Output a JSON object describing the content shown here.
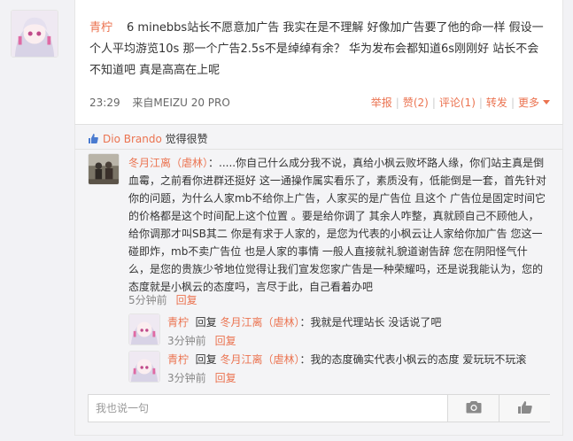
{
  "post": {
    "author": "青柠",
    "content": "6 minebbs站长不愿意加广告 我实在是不理解 好像加广告要了他的命一样 假设一个人平均游览10s 那一个广告2.5s不是绰绰有余？ 华为发布会都知道6s刚刚好 站长不会不知道吧 真是高高在上呢",
    "time": "23:29",
    "source": "来自MEIZU 20 PRO",
    "actions": {
      "report": "举报",
      "like": "赞(2)",
      "comment": "评论(1)",
      "repost": "转发",
      "more": "更多"
    }
  },
  "likes": {
    "liker": "Dio Brando",
    "suffix": " 觉得很赞"
  },
  "comment": {
    "author": "冬月江离（虐林）",
    "text": "：.....你自己什么成分我不说，真给小枫云败坏路人缘，你们站主真是倒血霉，之前看你进群还挺好 这一通操作属实看乐了，素质没有，低能倒是一套，首先针对你的问题，为什么人家mb不给你上广告，人家买的是广告位 且这个 广告位是固定时间它的价格都是这个时间配上这个位置 。要是给你调了 其余人咋整，真就顾自己不顾他人，给你调那才叫SB其二 你是有求于人家的，是您为代表的小枫云让人家给你加广告 您这一碰即炸，mb不卖广告位 也是人家的事情 一般人直接就礼貌道谢告辞 您在阴阳怪气什么，是您的贵族少爷地位觉得让我们宣发您家广告是一种荣耀吗，还是说我能认为，您的态度就是小枫云的态度吗，言尽于此，自己看着办吧",
    "time": "5分钟前",
    "reply_label": "回复"
  },
  "replies": [
    {
      "author": "青柠",
      "reply_word": "回复",
      "target": "冬月江离（虐林）",
      "text": "：我就是代理站长 没话说了吧",
      "time": "3分钟前",
      "reply_label": "回复"
    },
    {
      "author": "青柠",
      "reply_word": "回复",
      "target": "冬月江离（虐林）",
      "text": "：我的态度确实代表小枫云的态度 爱玩玩不玩滚",
      "time": "3分钟前",
      "reply_label": "回复"
    }
  ],
  "comment_input": {
    "placeholder": "我也说一句",
    "value": ""
  },
  "icons": {
    "camera": "camera-icon",
    "thumb": "thumbs-up-icon"
  },
  "colors": {
    "accent": "#eb7350",
    "like_blue": "#4a7bd0"
  }
}
